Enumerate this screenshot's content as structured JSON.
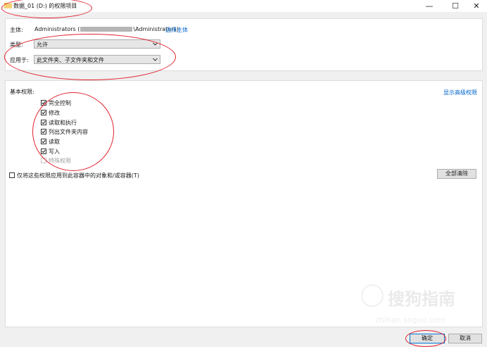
{
  "window": {
    "title": "数据_01 (D:) 的权限项目",
    "minimize_glyph": "—",
    "maximize_glyph": "☐",
    "close_glyph": "✕",
    "folder_icon": "folder-icon"
  },
  "principal": {
    "label": "主体:",
    "value_prefix": "Administrators (",
    "value_suffix": "\\Administrators)",
    "select_link": "选择主体"
  },
  "type": {
    "label": "类型:",
    "value": "允许"
  },
  "applies_to": {
    "label": "应用于:",
    "value": "此文件夹、子文件夹和文件"
  },
  "basic_permissions": {
    "heading": "基本权限:",
    "show_advanced_link": "显示高级权限",
    "items": [
      {
        "label": "完全控制",
        "checked": true,
        "enabled": true
      },
      {
        "label": "修改",
        "checked": true,
        "enabled": true
      },
      {
        "label": "读取和执行",
        "checked": true,
        "enabled": true
      },
      {
        "label": "列出文件夹内容",
        "checked": true,
        "enabled": true
      },
      {
        "label": "读取",
        "checked": true,
        "enabled": true
      },
      {
        "label": "写入",
        "checked": true,
        "enabled": true
      },
      {
        "label": "特殊权限",
        "checked": false,
        "enabled": false
      }
    ],
    "apply_only_label": "仅将这些权限应用到此容器中的对象和/或容器(T)",
    "apply_only_checked": false,
    "clear_all_button": "全部清除"
  },
  "footer": {
    "ok_button": "确定",
    "cancel_button": "取消"
  },
  "watermark": {
    "text": "搜狗指南",
    "url": "zhinan.sogou.com"
  },
  "colors": {
    "annotation": "#e0222e",
    "link": "#0066cc",
    "primary_border": "#0078d7"
  }
}
